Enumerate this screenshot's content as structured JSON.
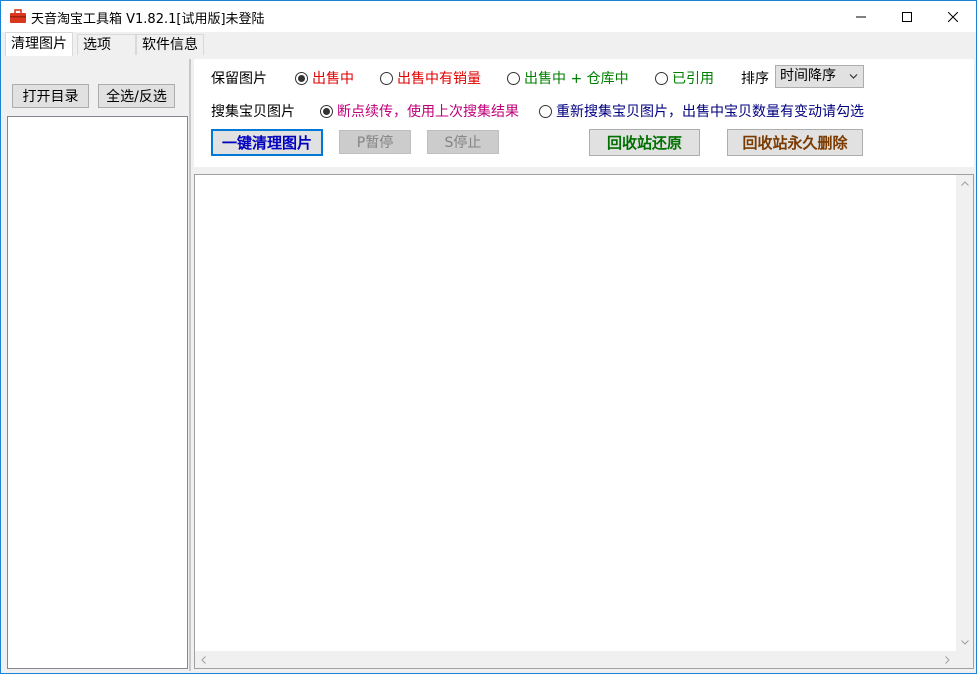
{
  "window": {
    "title": "天音淘宝工具箱 V1.82.1[试用版]未登陆"
  },
  "tabs": [
    {
      "label": "清理图片",
      "active": true
    },
    {
      "label": "选项",
      "active": false
    },
    {
      "label": "软件信息",
      "active": false
    }
  ],
  "left": {
    "open_dir_label": "打开目录",
    "select_all_label": "全选/反选"
  },
  "options": {
    "keep_label": "保留图片",
    "keep_options": [
      {
        "label": "出售中",
        "checked": true,
        "color": "#e00000"
      },
      {
        "label": "出售中有销量",
        "checked": false,
        "color": "#e00000"
      },
      {
        "label": "出售中 + 仓库中",
        "checked": false,
        "color": "#008000"
      },
      {
        "label": "已引用",
        "checked": false,
        "color": "#008000"
      }
    ],
    "sort_label": "排序",
    "sort_value": "时间降序",
    "collect_label": "搜集宝贝图片",
    "collect_options": [
      {
        "label": "断点续传，使用上次搜集结果",
        "checked": true,
        "color": "#c0007a"
      },
      {
        "label": "重新搜集宝贝图片，出售中宝贝数量有变动请勾选",
        "checked": false,
        "color": "#000080"
      }
    ]
  },
  "actions": {
    "clean_label": "一键清理图片",
    "pause_label": "P暂停",
    "stop_label": "S停止",
    "restore_label": "回收站还原",
    "delete_label": "回收站永久删除"
  },
  "colors": {
    "clean": "#0000c0",
    "restore": "#007000",
    "delete": "#7a3a00"
  }
}
